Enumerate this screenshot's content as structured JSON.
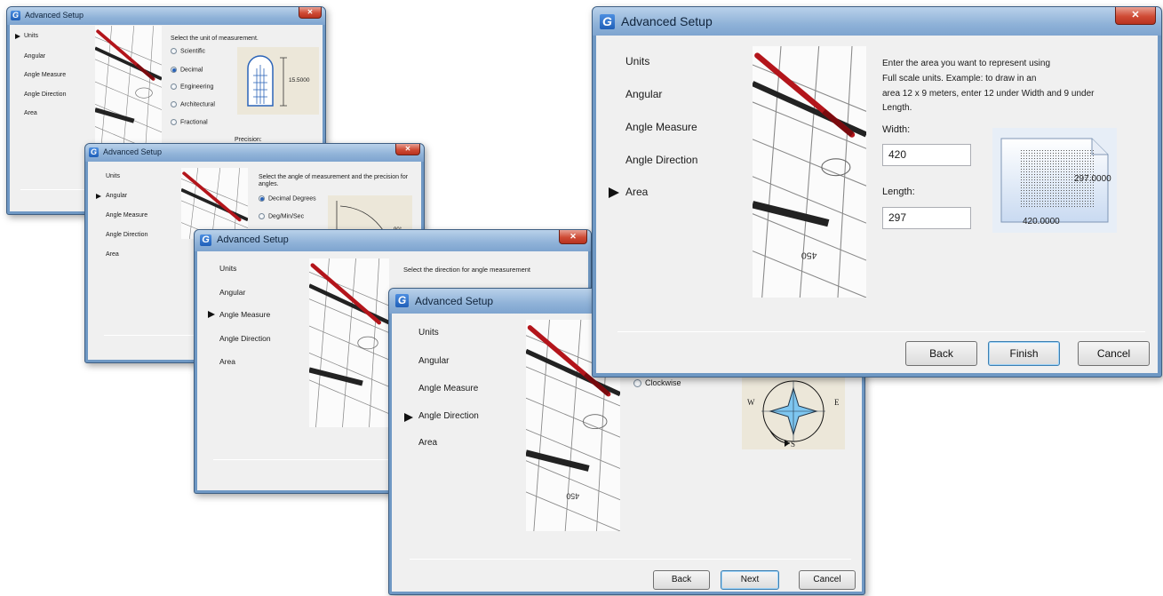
{
  "window_title": "Advanced Setup",
  "logo_letter": "G",
  "close_glyph": "✕",
  "nav": {
    "units": "Units",
    "angular": "Angular",
    "angle_measure": "Angle Measure",
    "angle_direction": "Angle Direction",
    "area": "Area"
  },
  "units_page": {
    "prompt": "Select the unit of measurement.",
    "options": [
      "Scientific",
      "Decimal",
      "Engineering",
      "Architectural",
      "Fractional"
    ],
    "selected": "Decimal",
    "dimension": "15.5000",
    "precision_label": "Precision:"
  },
  "angular_page": {
    "prompt": "Select the angle of measurement and the precision for angles.",
    "options": [
      "Decimal Degrees",
      "Deg/Min/Sec"
    ],
    "selected": "Decimal Degrees",
    "angle_value": "90°"
  },
  "angle_measure_page": {
    "prompt": "Select the direction for angle measurement"
  },
  "angle_direction_page": {
    "option": "Clockwise",
    "compass": {
      "west": "W",
      "east": "E",
      "south": "S"
    }
  },
  "area_page": {
    "line1": "Enter the area you want to represent using",
    "line2": "Full scale units. Example: to draw in an",
    "line3": "area 12 x 9 meters, enter 12 under Width and 9 under",
    "line4": "Length.",
    "width_label": "Width:",
    "width_value": "420",
    "length_label": "Length:",
    "length_value": "297",
    "preview_length": "297.0000",
    "preview_width": "420.0000"
  },
  "buttons": {
    "back": "Back",
    "next": "Next",
    "finish": "Finish",
    "cancel": "Cancel"
  },
  "colors": {
    "accent": "#2a63b8",
    "titlebar": "#8fb2d8",
    "close": "#cf4b35",
    "pen": "#b3151b"
  }
}
